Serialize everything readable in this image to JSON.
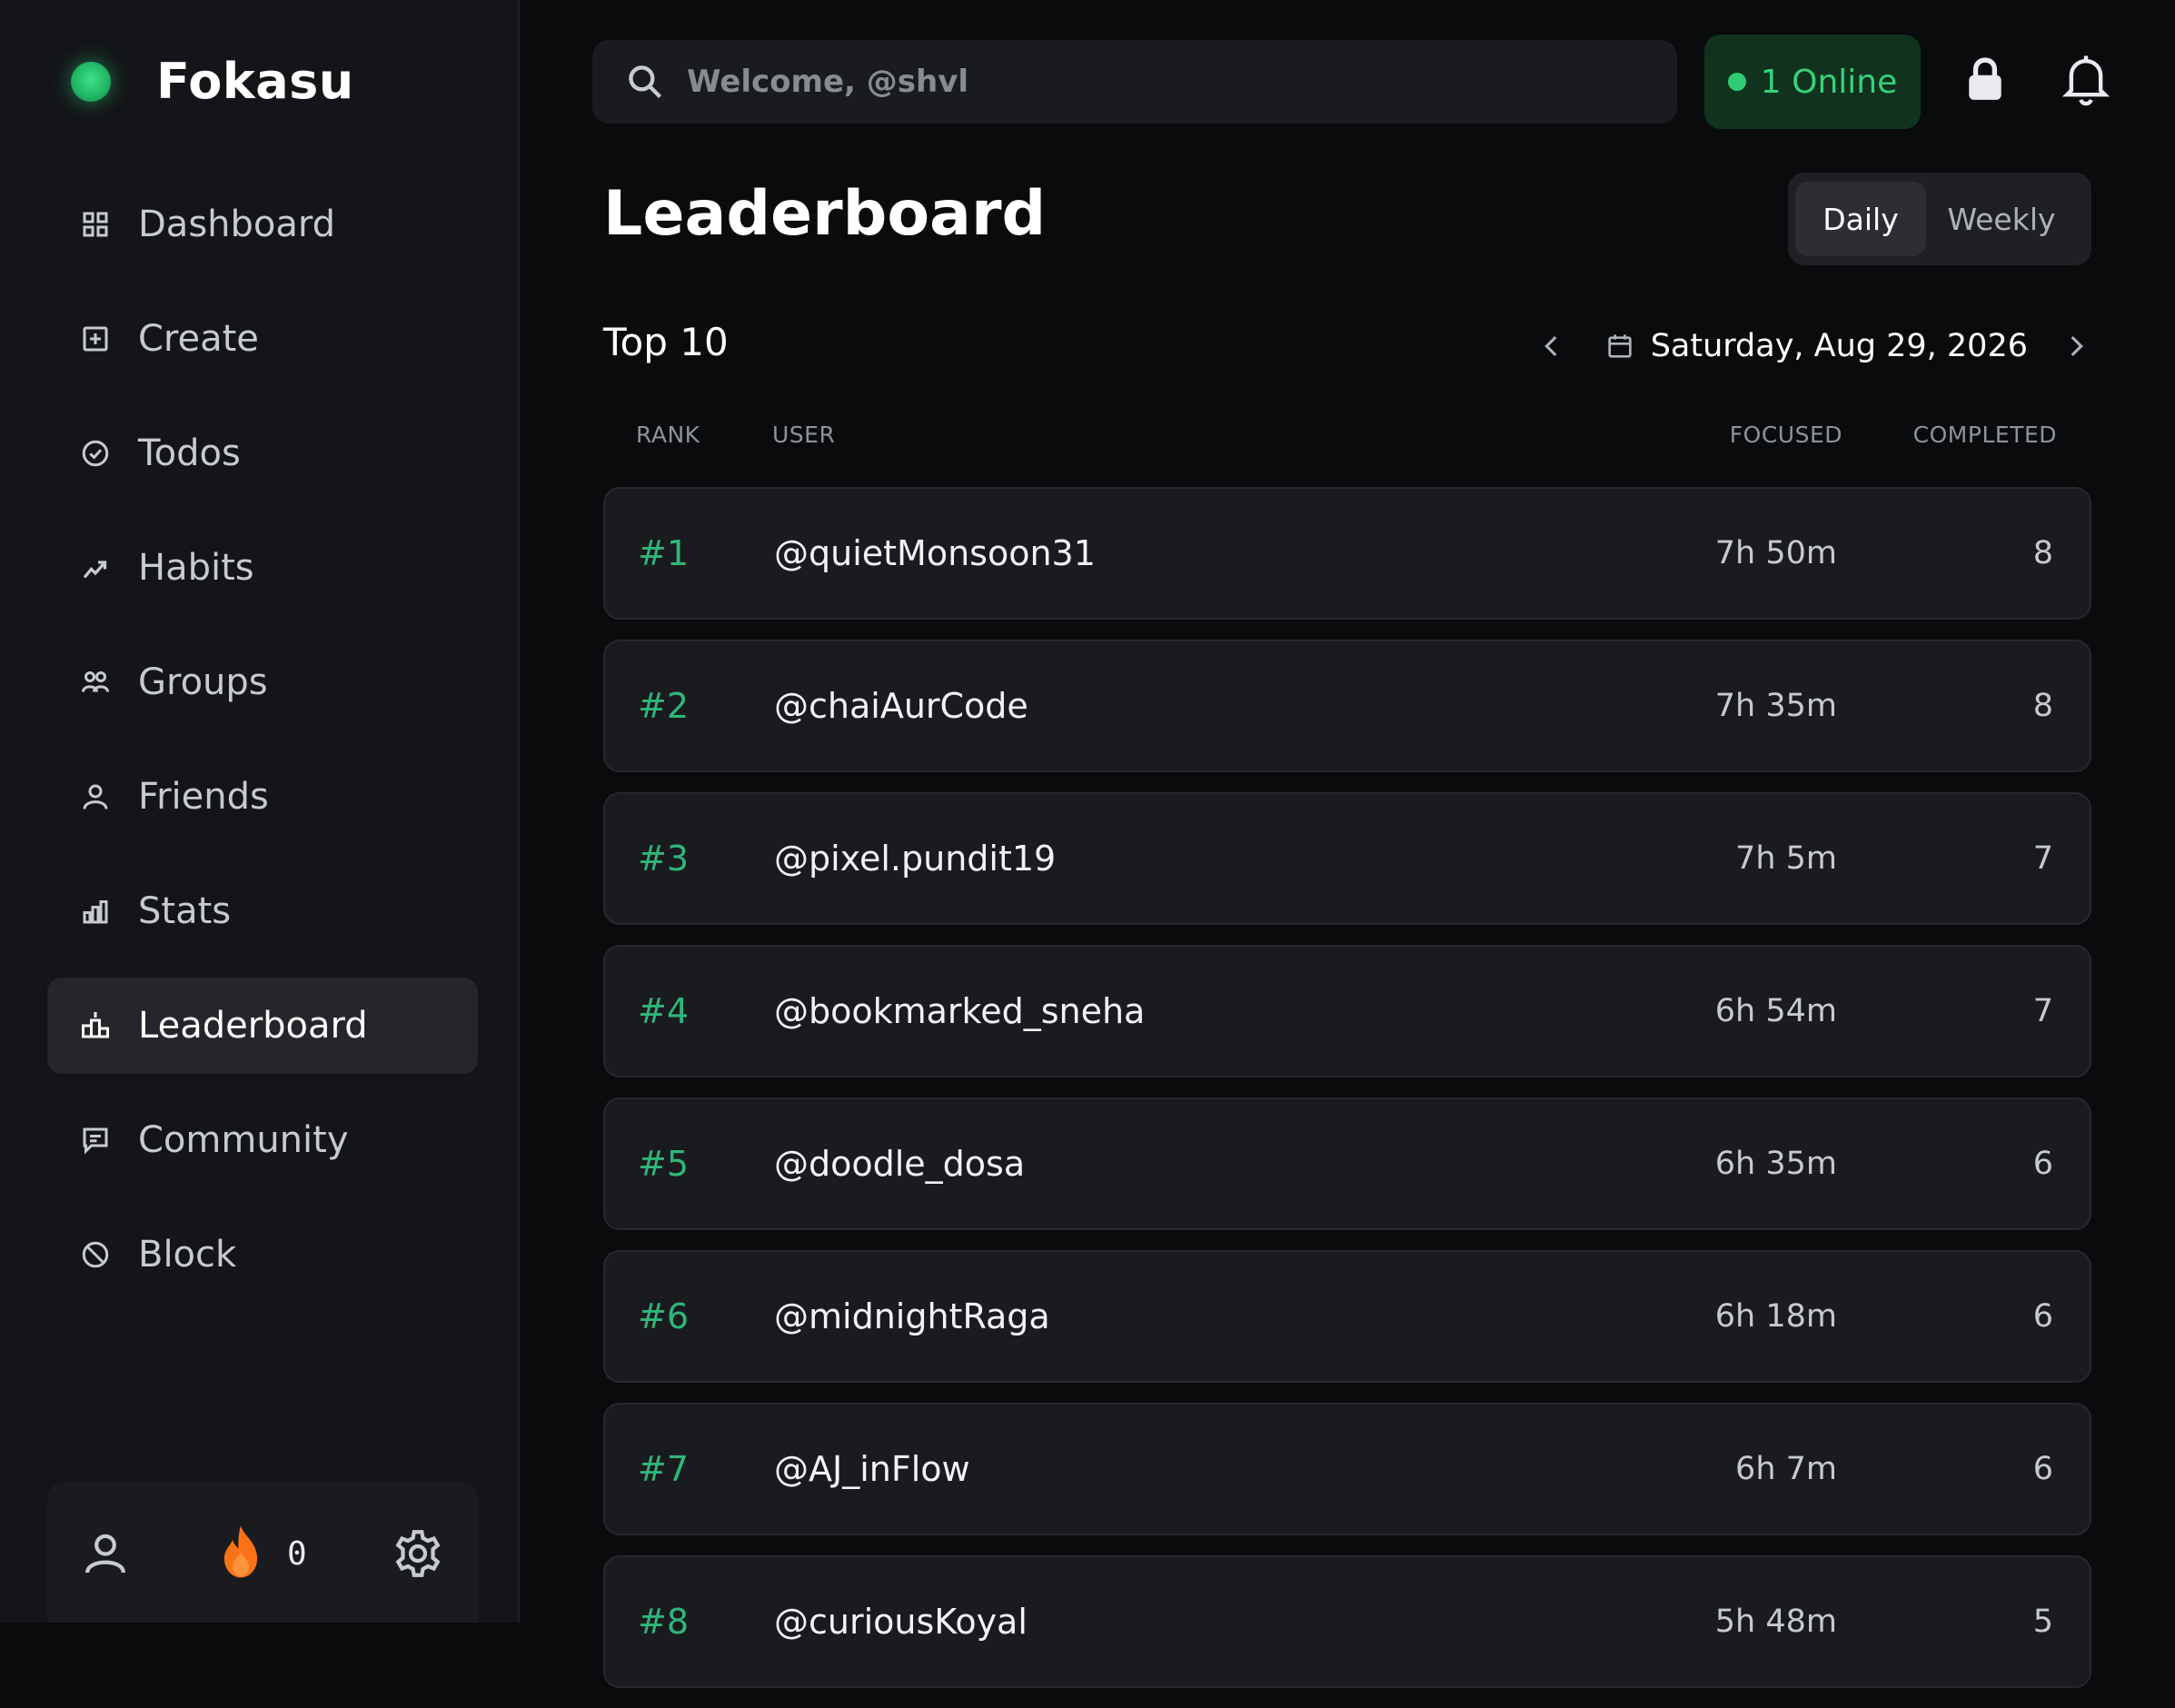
{
  "app": {
    "name": "Fokasu"
  },
  "sidebar": {
    "items": [
      {
        "label": "Dashboard",
        "icon": "grid-icon"
      },
      {
        "label": "Create",
        "icon": "plus-square-icon"
      },
      {
        "label": "Todos",
        "icon": "check-circle-icon"
      },
      {
        "label": "Habits",
        "icon": "trend-icon"
      },
      {
        "label": "Groups",
        "icon": "group-icon"
      },
      {
        "label": "Friends",
        "icon": "user-icon"
      },
      {
        "label": "Stats",
        "icon": "bar-chart-icon"
      },
      {
        "label": "Leaderboard",
        "icon": "podium-icon",
        "active": true
      },
      {
        "label": "Community",
        "icon": "message-icon"
      },
      {
        "label": "Block",
        "icon": "block-icon"
      }
    ],
    "footer": {
      "streak_count": "0"
    }
  },
  "header": {
    "search_placeholder": "Welcome, @shvl",
    "online_label": "1 Online"
  },
  "page": {
    "title": "Leaderboard",
    "toggle": {
      "daily": "Daily",
      "weekly": "Weekly",
      "selected": "Daily"
    },
    "subtitle": "Top 10",
    "date": "Saturday, Aug 29, 2026"
  },
  "table": {
    "columns": {
      "rank": "RANK",
      "user": "USER",
      "focused": "FOCUSED",
      "completed": "COMPLETED"
    },
    "rows": [
      {
        "rank": "#1",
        "user": "@quietMonsoon31",
        "focused": "7h 50m",
        "completed": "8"
      },
      {
        "rank": "#2",
        "user": "@chaiAurCode",
        "focused": "7h 35m",
        "completed": "8"
      },
      {
        "rank": "#3",
        "user": "@pixel.pundit19",
        "focused": "7h 5m",
        "completed": "7"
      },
      {
        "rank": "#4",
        "user": "@bookmarked_sneha",
        "focused": "6h 54m",
        "completed": "7"
      },
      {
        "rank": "#5",
        "user": "@doodle_dosa",
        "focused": "6h 35m",
        "completed": "6"
      },
      {
        "rank": "#6",
        "user": "@midnightRaga",
        "focused": "6h 18m",
        "completed": "6"
      },
      {
        "rank": "#7",
        "user": "@AJ_inFlow",
        "focused": "6h 7m",
        "completed": "6"
      },
      {
        "rank": "#8",
        "user": "@curiousKoyal",
        "focused": "5h 48m",
        "completed": "5"
      }
    ]
  },
  "colors": {
    "accent_green": "#2fb67a",
    "online_green": "#36d27a",
    "streak_orange": "#f97316",
    "background": "#0a0b0d",
    "sidebar": "#141518",
    "row": "#1a1b1f"
  }
}
